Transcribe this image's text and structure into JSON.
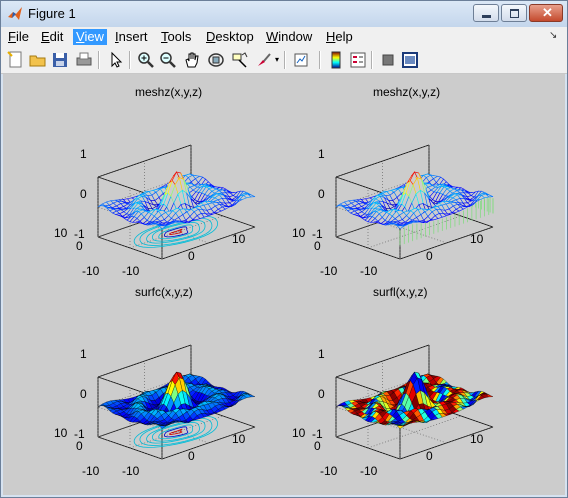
{
  "window": {
    "title": "Figure 1"
  },
  "menu": [
    {
      "label": "File",
      "key": "F",
      "rest": "ile"
    },
    {
      "label": "Edit",
      "key": "E",
      "rest": "dit"
    },
    {
      "label": "View",
      "key": "V",
      "rest": "iew",
      "active": true
    },
    {
      "label": "Insert",
      "key": "I",
      "rest": "nsert"
    },
    {
      "label": "Tools",
      "key": "T",
      "rest": "ools"
    },
    {
      "label": "Desktop",
      "key": "D",
      "rest": "esktop"
    },
    {
      "label": "Window",
      "key": "W",
      "rest": "indow"
    },
    {
      "label": "Help",
      "key": "H",
      "rest": "elp"
    }
  ],
  "toolbar_icons": [
    "new-figure-icon",
    "open-file-icon",
    "save-icon",
    "print-icon",
    "edit-plot-arrow-icon",
    "zoom-in-icon",
    "zoom-out-icon",
    "pan-hand-icon",
    "rotate-3d-icon",
    "data-cursor-icon",
    "brush-icon",
    "link-plot-icon",
    "colorbar-icon",
    "legend-icon",
    "hide-plot-tools-icon",
    "show-plot-tools-icon"
  ],
  "plots": [
    {
      "title": "meshz(x,y,z)",
      "z_ticks": [
        "1",
        "0",
        "-1"
      ],
      "y_ticks": [
        "10",
        "0",
        "-10"
      ],
      "x_ticks": [
        "-10",
        "0",
        "10"
      ],
      "style": "meshz-contour"
    },
    {
      "title": "meshz(x,y,z)",
      "z_ticks": [
        "1",
        "0",
        "-1"
      ],
      "y_ticks": [
        "10",
        "0",
        "-10"
      ],
      "x_ticks": [
        "-10",
        "0",
        "10"
      ],
      "style": "meshz-curtain"
    },
    {
      "title": "surfc(x,y,z)",
      "z_ticks": [
        "1",
        "0",
        "-1"
      ],
      "y_ticks": [
        "10",
        "0",
        "-10"
      ],
      "x_ticks": [
        "-10",
        "0",
        "10"
      ],
      "style": "surfc"
    },
    {
      "title": "surfl(x,y,z)",
      "z_ticks": [
        "1",
        "0",
        "-1"
      ],
      "y_ticks": [
        "10",
        "0",
        "-10"
      ],
      "x_ticks": [
        "-10",
        "0",
        "10"
      ],
      "style": "surfl"
    }
  ],
  "colors": {
    "figure_bg": "#cccccc",
    "menu_active": "#3399ff"
  }
}
